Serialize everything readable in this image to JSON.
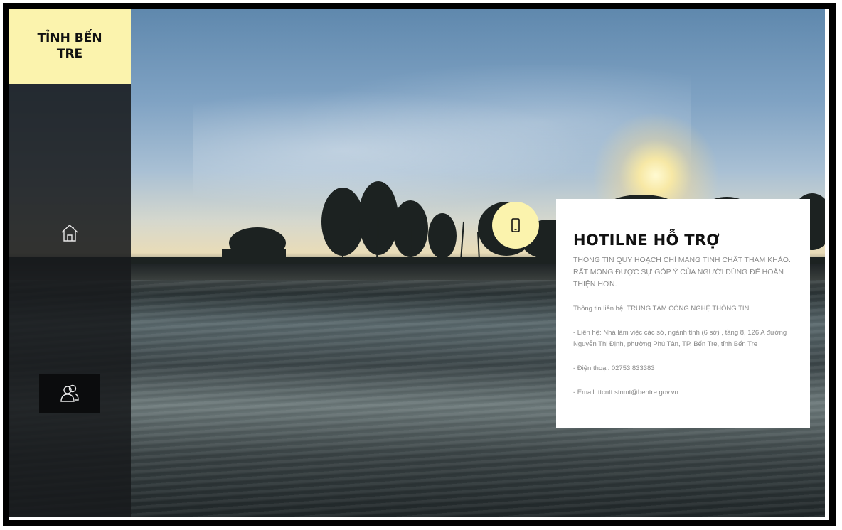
{
  "brand": {
    "title": "TỈNH BẾN TRE"
  },
  "nav": {
    "home_icon": "home-icon",
    "users_icon": "users-icon"
  },
  "hotline": {
    "badge_icon": "phone-icon",
    "title": "HOTILNE HỖ TRỢ",
    "subtitle": "THÔNG TIN QUY HOẠCH CHỈ MANG TÍNH CHẤT THAM KHẢO. RẤT MONG ĐƯỢC SỰ GÓP Ý CỦA NGƯỜI DÙNG ĐỂ HOÀN THIỆN HƠN.",
    "contact": "Thông tin liên hệ: TRUNG TÂM CÔNG NGHỆ THÔNG TIN",
    "address": "- Liên hệ: Nhà làm việc các sở, ngành tỉnh (6 sở) , tầng 8, 126 A đường Nguyễn Thị Định, phường Phú Tân, TP. Bến Tre, tỉnh Bến Tre",
    "phone": "- Điện thoại: 02753 833383",
    "email": "- Email: ttcntt.stnmt@bentre.gov.vn"
  },
  "colors": {
    "brand_bg": "#fbf3ad",
    "sidebar_bg": "#181a1c",
    "card_bg": "#ffffff"
  }
}
